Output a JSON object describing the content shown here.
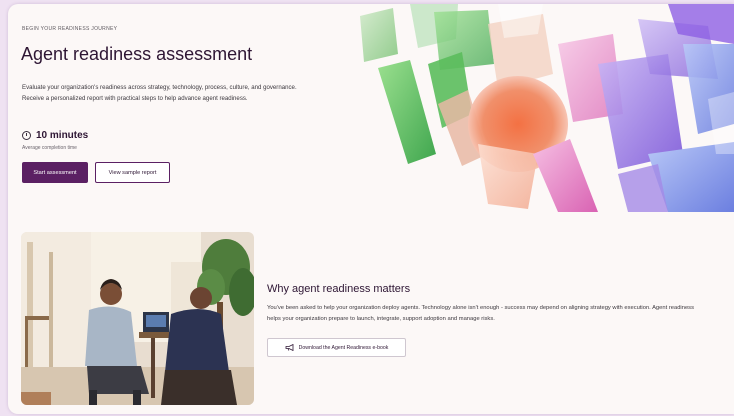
{
  "hero": {
    "eyebrow": "BEGIN YOUR READINESS JOURNEY",
    "title": "Agent readiness assessment",
    "description": "Evaluate your organization's readiness across strategy, technology, process, culture, and governance. Receive a personalized report with practical steps to help advance agent readiness.",
    "duration": "10 minutes",
    "duration_caption": "Average completion time",
    "start_button": "Start assessment",
    "sample_button": "View sample report"
  },
  "why": {
    "title": "Why agent readiness matters",
    "description": "You've been asked to help your organization deploy agents. Technology alone isn't enough - success may depend on aligning strategy with execution. Agent readiness helps your organization prepare to launch, integrate, support adoption and manage risks.",
    "download_button": "Download the Agent Readiness e-book"
  },
  "icons": {
    "duration": "clock-icon",
    "download": "megaphone-icon"
  },
  "colors": {
    "accent": "#5b2063",
    "heading": "#2e1634",
    "background": "#fcf8f7",
    "outer": "#efe2f2"
  }
}
